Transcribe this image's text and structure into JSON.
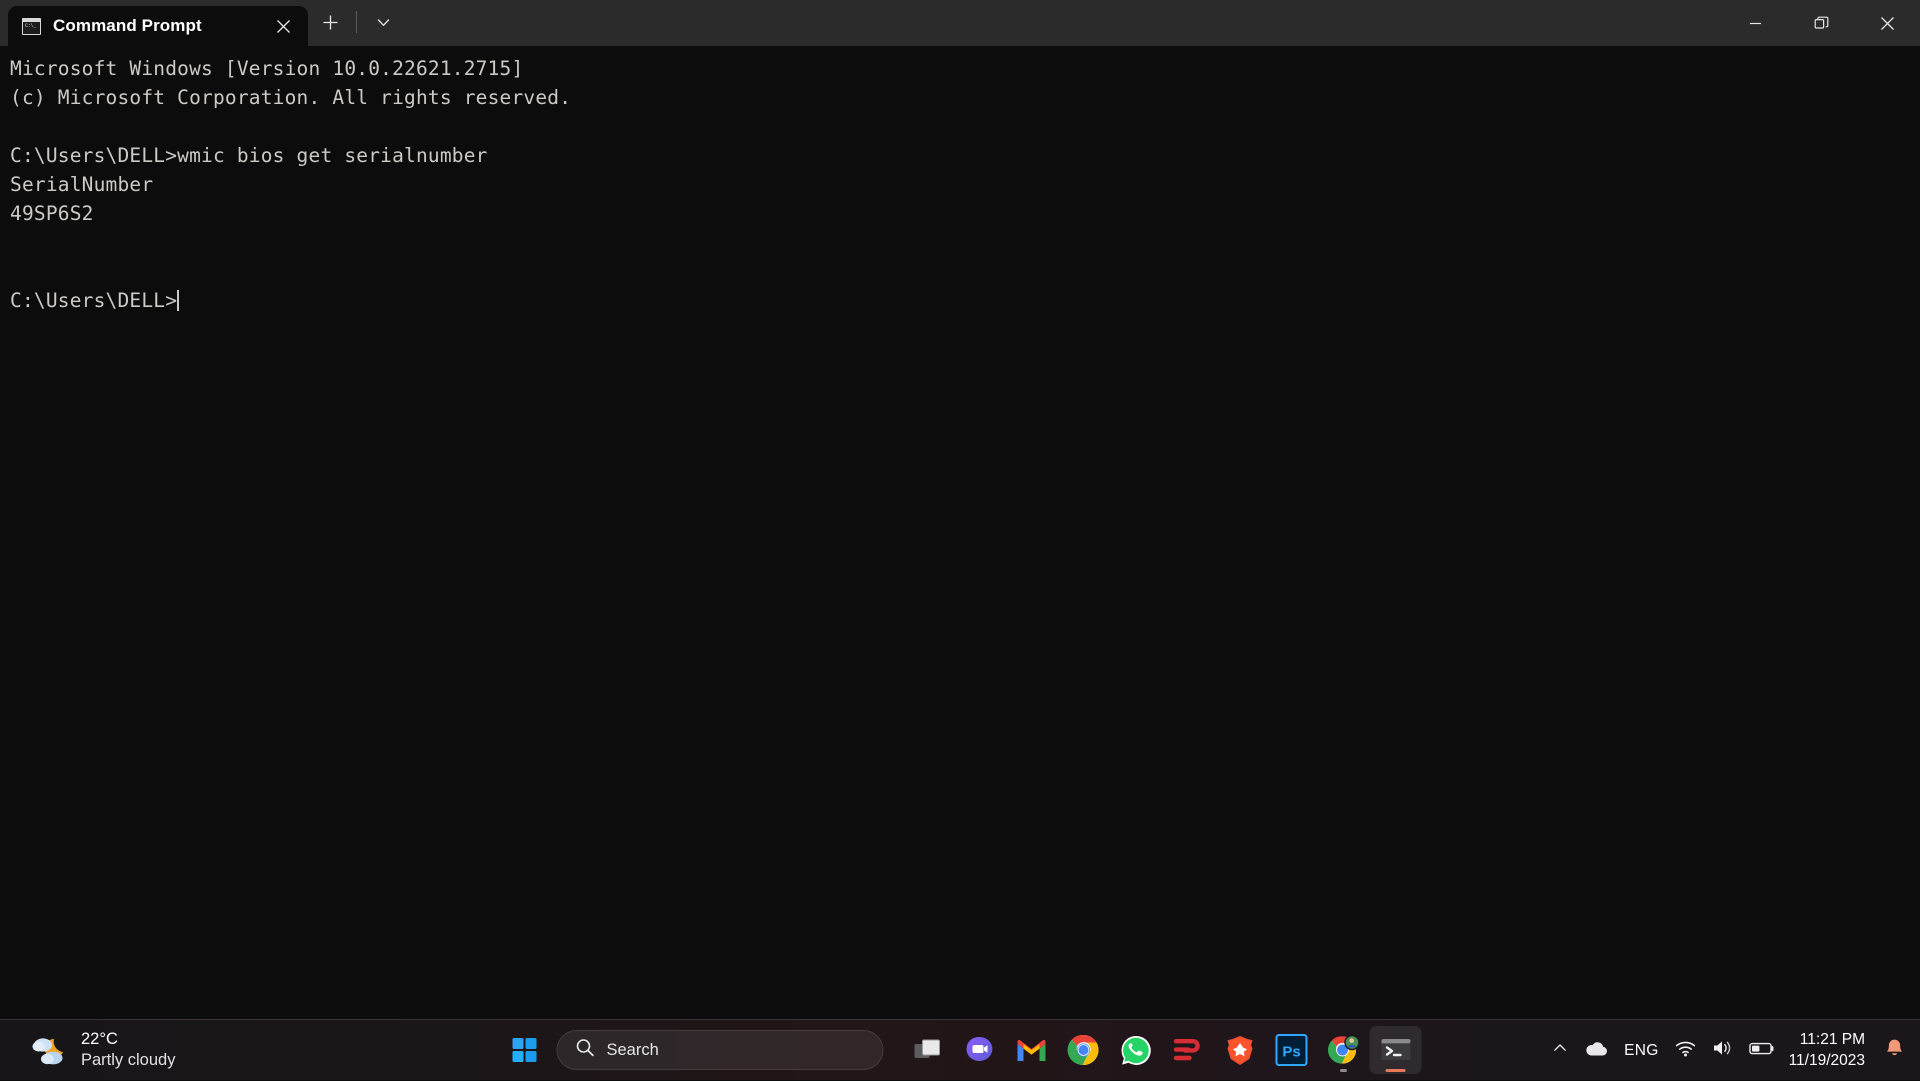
{
  "window": {
    "tab": {
      "title": "Command Prompt",
      "icon": "cmd-icon",
      "close_icon": "close-icon"
    },
    "new_tab_icon": "plus-icon",
    "tab_dropdown_icon": "chevron-down-icon",
    "caption": {
      "minimize_icon": "minimize-icon",
      "restore_icon": "restore-icon",
      "close_icon": "close-icon"
    }
  },
  "terminal": {
    "lines": [
      "Microsoft Windows [Version 10.0.22621.2715]",
      "(c) Microsoft Corporation. All rights reserved.",
      "",
      "C:\\Users\\DELL>wmic bios get serialnumber",
      "SerialNumber",
      "49SP6S2",
      "",
      ""
    ],
    "prompt": "C:\\Users\\DELL>",
    "cursor": "text-cursor",
    "background_color": "#0c0c0c",
    "foreground_color": "#ccc9c6"
  },
  "taskbar": {
    "weather": {
      "temperature": "22°C",
      "condition": "Partly cloudy",
      "icon": "partly-cloudy-night-icon"
    },
    "start": {
      "label": "Start",
      "icon": "windows-logo-icon"
    },
    "search": {
      "placeholder": "Search",
      "icon": "search-icon"
    },
    "apps": [
      {
        "name": "task-view",
        "icon": "task-view-icon",
        "state": "idle"
      },
      {
        "name": "chat",
        "icon": "chat-video-icon",
        "state": "idle"
      },
      {
        "name": "gmail",
        "icon": "gmail-icon",
        "state": "idle"
      },
      {
        "name": "chrome",
        "icon": "chrome-icon",
        "state": "idle"
      },
      {
        "name": "whatsapp",
        "icon": "whatsapp-icon",
        "state": "idle"
      },
      {
        "name": "expressvpn",
        "icon": "expressvpn-icon",
        "state": "idle"
      },
      {
        "name": "brave",
        "icon": "brave-icon",
        "state": "idle"
      },
      {
        "name": "photoshop",
        "icon": "photoshop-icon",
        "state": "idle"
      },
      {
        "name": "chrome-window",
        "icon": "chrome-avatar-icon",
        "state": "running"
      },
      {
        "name": "terminal",
        "icon": "terminal-icon",
        "state": "active"
      }
    ],
    "tray": {
      "overflow_icon": "chevron-up-icon",
      "onedrive_icon": "onedrive-cloud-icon",
      "language": "ENG",
      "wifi_icon": "wifi-icon",
      "volume_icon": "speaker-icon",
      "battery_icon": "battery-icon",
      "time": "11:21 PM",
      "date": "11/19/2023",
      "notification_icon": "bell-icon"
    },
    "accent_color": "#e8795a"
  }
}
